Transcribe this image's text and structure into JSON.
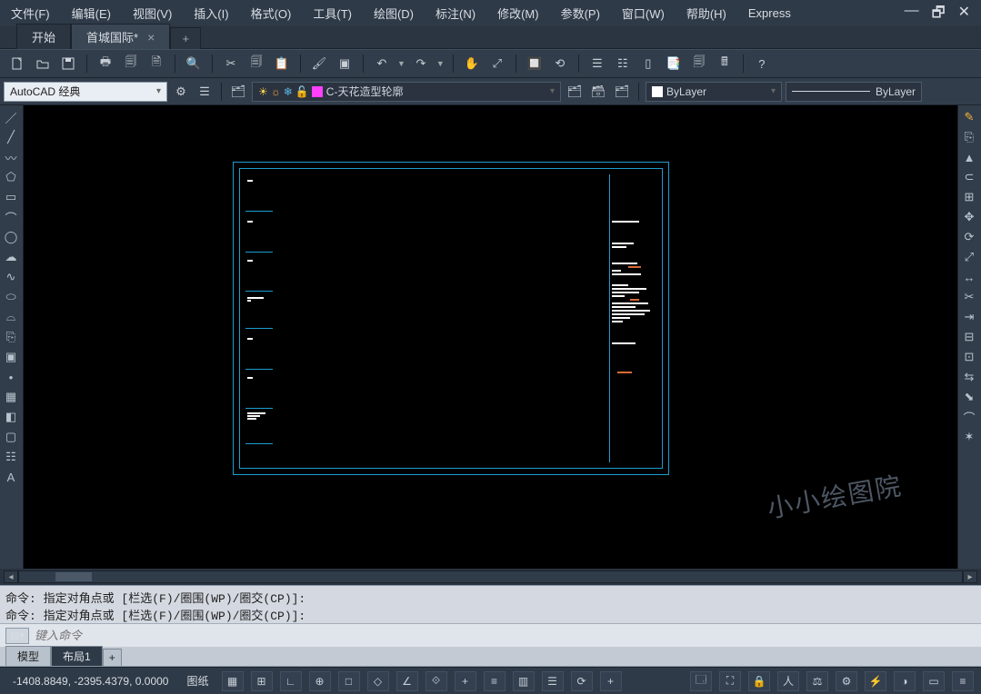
{
  "menu": {
    "file": "文件(F)",
    "edit": "编辑(E)",
    "view": "视图(V)",
    "insert": "插入(I)",
    "format": "格式(O)",
    "tools": "工具(T)",
    "draw": "绘图(D)",
    "dimension": "标注(N)",
    "modify": "修改(M)",
    "parametric": "参数(P)",
    "window": "窗口(W)",
    "help": "帮助(H)",
    "express": "Express"
  },
  "tabs": {
    "start": "开始",
    "doc": "首城国际*",
    "add": "+"
  },
  "toolbar2": {
    "workspace": "AutoCAD 经典",
    "layer_name": " C-天花造型轮廓",
    "bylayer_text": "ByLayer",
    "bylayer_line": "ByLayer"
  },
  "command": {
    "prefix": "命令:",
    "line": " 指定对角点或 [栏选(F)/圈围(WP)/圈交(CP)]:",
    "placeholder": "键入命令"
  },
  "layout": {
    "model": "模型",
    "layout1": "布局1",
    "add": "+"
  },
  "status": {
    "coords": "-1408.8849, -2395.4379, 0.0000",
    "space": "图纸"
  },
  "watermark": "小小绘图院"
}
